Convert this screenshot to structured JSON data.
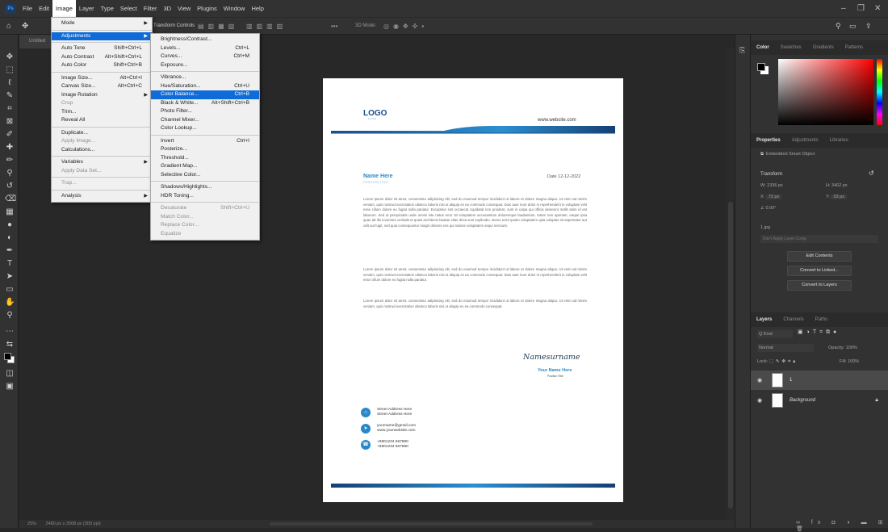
{
  "menubar": {
    "logo": "Ps",
    "items": [
      "File",
      "Edit",
      "Image",
      "Layer",
      "Type",
      "Select",
      "Filter",
      "3D",
      "View",
      "Plugins",
      "Window",
      "Help"
    ]
  },
  "optionsbar": {
    "transform_controls": "Transform Controls",
    "mode_3d": "3D Mode:"
  },
  "document": {
    "tab_title": "Untitled"
  },
  "image_menu": [
    {
      "label": "Mode",
      "arrow": true
    },
    {
      "sep": true
    },
    {
      "label": "Adjustments",
      "arrow": true,
      "highlight": true
    },
    {
      "sep": true
    },
    {
      "label": "Auto Tone",
      "shortcut": "Shift+Ctrl+L"
    },
    {
      "label": "Auto Contrast",
      "shortcut": "Alt+Shift+Ctrl+L"
    },
    {
      "label": "Auto Color",
      "shortcut": "Shift+Ctrl+B"
    },
    {
      "sep": true
    },
    {
      "label": "Image Size...",
      "shortcut": "Alt+Ctrl+I"
    },
    {
      "label": "Canvas Size...",
      "shortcut": "Alt+Ctrl+C"
    },
    {
      "label": "Image Rotation",
      "arrow": true
    },
    {
      "label": "Crop",
      "disabled": true
    },
    {
      "label": "Trim..."
    },
    {
      "label": "Reveal All"
    },
    {
      "sep": true
    },
    {
      "label": "Duplicate..."
    },
    {
      "label": "Apply Image...",
      "disabled": true
    },
    {
      "label": "Calculations..."
    },
    {
      "sep": true
    },
    {
      "label": "Variables",
      "arrow": true
    },
    {
      "label": "Apply Data Set...",
      "disabled": true
    },
    {
      "sep": true
    },
    {
      "label": "Trap...",
      "disabled": true
    },
    {
      "sep": true
    },
    {
      "label": "Analysis",
      "arrow": true
    }
  ],
  "adjustments_menu": [
    {
      "label": "Brightness/Contrast..."
    },
    {
      "label": "Levels...",
      "shortcut": "Ctrl+L"
    },
    {
      "label": "Curves...",
      "shortcut": "Ctrl+M"
    },
    {
      "label": "Exposure..."
    },
    {
      "sep": true
    },
    {
      "label": "Vibrance..."
    },
    {
      "label": "Hue/Saturation...",
      "shortcut": "Ctrl+U"
    },
    {
      "label": "Color Balance...",
      "shortcut": "Ctrl+B",
      "highlight": true
    },
    {
      "label": "Black & White...",
      "shortcut": "Alt+Shift+Ctrl+B"
    },
    {
      "label": "Photo Filter..."
    },
    {
      "label": "Channel Mixer..."
    },
    {
      "label": "Color Lookup..."
    },
    {
      "sep": true
    },
    {
      "label": "Invert",
      "shortcut": "Ctrl+I"
    },
    {
      "label": "Posterize..."
    },
    {
      "label": "Threshold..."
    },
    {
      "label": "Gradient Map..."
    },
    {
      "label": "Selective Color..."
    },
    {
      "sep": true
    },
    {
      "label": "Shadows/Highlights..."
    },
    {
      "label": "HDR Toning..."
    },
    {
      "sep": true
    },
    {
      "label": "Desaturate",
      "shortcut": "Shift+Ctrl+U",
      "disabled": true
    },
    {
      "label": "Match Color...",
      "disabled": true
    },
    {
      "label": "Replace Color...",
      "disabled": true
    },
    {
      "label": "Equalize",
      "disabled": true
    }
  ],
  "letterhead": {
    "logo": "LOGO",
    "logo_sub": "NAME",
    "website": "www.website.com",
    "name": "Name Here",
    "position": "POSITION TITLE",
    "date": "Date 12-12-2022",
    "para1": "Lorem ipsum dolor sit amet, consectetur adipisicing elit, sed do eiusmod tempor incididunt ut labore et dolore magna aliqua. Ut enim ad minim veniam, quis nostrud exercitation ullamco laboris nisi ut aliquip ex ea commodo consequat. Duis aute irure dolor in reprehenderit in voluptate velit esse cillum dolore eu fugiat nulla pariatur. Excepteur sint occaecat cupidatat non proident, sunt in culpa qui officia deserunt mollit anim id est laborum. Sed ut perspiciatis unde omnis iste natus error sit voluptatem accusantium doloremque laudantium, totam rem aperiam, eaque ipsa quae ab illo inventore veritatis et quasi architecto beatae vitae dicta sunt explicabo. Nemo enim ipsam voluptatem quia voluptas sit aspernatur aut odit aut fugit, sed quia consequuntur magni dolores eos qui ratione voluptatem sequi nesciunt.",
    "para2": "Lorem ipsum dolor sit amet, consectetur adipisicing elit, sed do eiusmod tempor incididunt ut labore et dolore magna aliqua. Ut enim ad minim veniam, quis nostrud exercitation ullamco laboris nisi ut aliquip ex ea commodo consequat. Duis aute irure dolor in reprehenderit in voluptate velit esse cillum dolore eu fugiat nulla pariatur.",
    "para3": "Lorem ipsum dolor sit amet, consectetur adipisicing elit, sed do eiusmod tempor incididunt ut labore et dolore magna aliqua. Ut enim ad minim veniam, quis nostrud exercitation ullamco laboris nisi ut aliquip ex ea commodo consequat.",
    "signature": "Namesurname",
    "sig_name": "Your Name Here",
    "sig_position": "Position Title",
    "address1": "Street Address Here",
    "address2": "Street Address Here",
    "email": "yourname@gmail.com",
    "web2": "www.yourwebsite.com",
    "phone1": "+8801234 567890",
    "phone2": "+8801234 567890",
    "accent": "#2788c9",
    "bar_color": "#19508a"
  },
  "color_panel": {
    "tabs": [
      "Color",
      "Swatches",
      "Gradients",
      "Patterns"
    ]
  },
  "properties_panel": {
    "tabs": [
      "Properties",
      "Adjustments",
      "Libraries"
    ],
    "object_type": "Embedded Smart Object",
    "transform_label": "Transform",
    "w_label": "W:",
    "w_value": "2336 px",
    "h_label": "H:",
    "h_value": "3402 px",
    "x_label": "X:",
    "x_value": "72 px",
    "y_label": "Y:",
    "y_value": "53 px",
    "angle_value": "0.00°",
    "file_name": "1.jpg",
    "layer_comp": "Don't Apply Layer Comp",
    "edit_contents": "Edit Contents",
    "convert_linked": "Convert to Linked...",
    "convert_layers": "Convert to Layers"
  },
  "layers_panel": {
    "tabs": [
      "Layers",
      "Channels",
      "Paths"
    ],
    "kind_label": "Q Kind",
    "blend_mode": "Normal",
    "opacity_label": "Opacity:",
    "opacity_value": "100%",
    "lock_label": "Lock:",
    "fill_label": "Fill:",
    "fill_value": "100%",
    "layers": [
      {
        "name": "1",
        "selected": true
      },
      {
        "name": "Background",
        "locked": true
      }
    ]
  },
  "statusbar": {
    "zoom": "25%",
    "doc_info": "2480 px x 3508 px (300 ppi)"
  }
}
